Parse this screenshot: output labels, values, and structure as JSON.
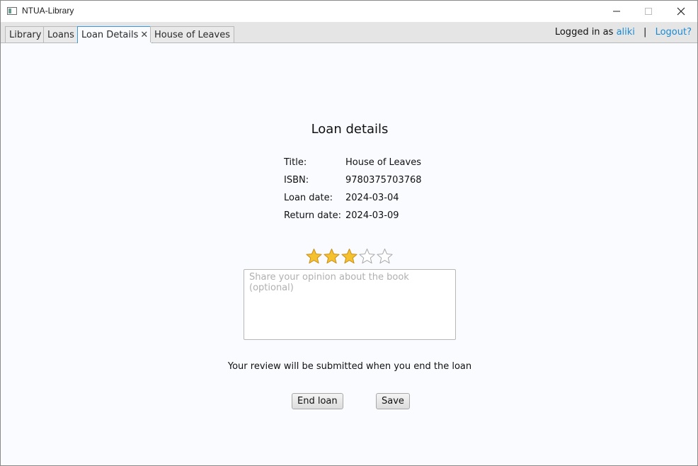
{
  "window": {
    "title": "NTUA-Library",
    "controls": {
      "minimize_icon": "minimize-icon",
      "maximize_icon": "maximize-icon",
      "close_icon": "close-icon"
    }
  },
  "tabs": [
    {
      "label": "Library",
      "active": false,
      "closable": false
    },
    {
      "label": "Loans",
      "active": false,
      "closable": false
    },
    {
      "label": "Loan Details",
      "active": true,
      "closable": true
    },
    {
      "label": "House of Leaves",
      "active": false,
      "closable": false
    }
  ],
  "session": {
    "prefix": "Logged in as",
    "username": "aliki",
    "separator": "|",
    "logout_label": "Logout?"
  },
  "loan": {
    "heading": "Loan details",
    "fields": [
      {
        "label": "Title:",
        "value": "House of Leaves"
      },
      {
        "label": "ISBN:",
        "value": "9780375703768"
      },
      {
        "label": "Loan date:",
        "value": "2024-03-04"
      },
      {
        "label": "Return date:",
        "value": "2024-03-09"
      }
    ]
  },
  "rating": {
    "value": 3,
    "max": 5,
    "filled_color": "#f6c12e",
    "empty_color": "#ffffff"
  },
  "review": {
    "value": "",
    "placeholder": "Share your opinion about the book (optional)"
  },
  "note": "Your review will be submitted when you end the loan",
  "actions": {
    "end_loan_label": "End loan",
    "save_label": "Save"
  },
  "colors": {
    "accent": "#1a8ad4",
    "active_tab_border": "#3d97d3"
  }
}
